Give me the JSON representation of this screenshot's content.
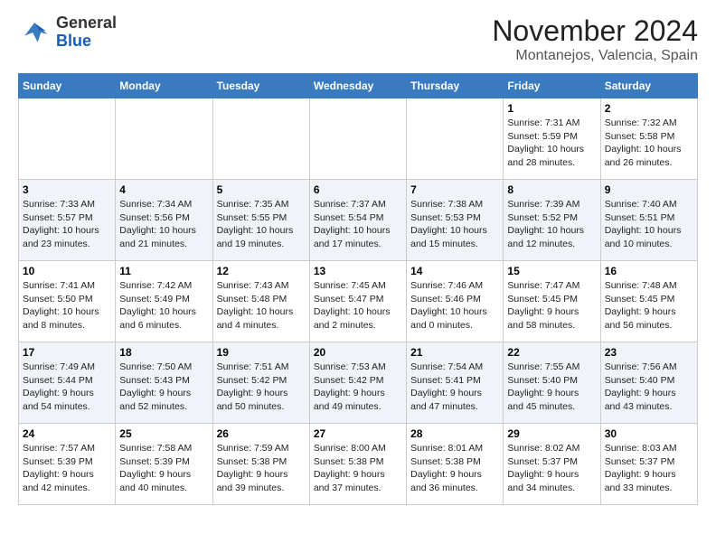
{
  "logo": {
    "general": "General",
    "blue": "Blue"
  },
  "title": "November 2024",
  "subtitle": "Montanejos, Valencia, Spain",
  "days_of_week": [
    "Sunday",
    "Monday",
    "Tuesday",
    "Wednesday",
    "Thursday",
    "Friday",
    "Saturday"
  ],
  "weeks": [
    [
      {
        "day": "",
        "info": ""
      },
      {
        "day": "",
        "info": ""
      },
      {
        "day": "",
        "info": ""
      },
      {
        "day": "",
        "info": ""
      },
      {
        "day": "",
        "info": ""
      },
      {
        "day": "1",
        "info": "Sunrise: 7:31 AM\nSunset: 5:59 PM\nDaylight: 10 hours\nand 28 minutes."
      },
      {
        "day": "2",
        "info": "Sunrise: 7:32 AM\nSunset: 5:58 PM\nDaylight: 10 hours\nand 26 minutes."
      }
    ],
    [
      {
        "day": "3",
        "info": "Sunrise: 7:33 AM\nSunset: 5:57 PM\nDaylight: 10 hours\nand 23 minutes."
      },
      {
        "day": "4",
        "info": "Sunrise: 7:34 AM\nSunset: 5:56 PM\nDaylight: 10 hours\nand 21 minutes."
      },
      {
        "day": "5",
        "info": "Sunrise: 7:35 AM\nSunset: 5:55 PM\nDaylight: 10 hours\nand 19 minutes."
      },
      {
        "day": "6",
        "info": "Sunrise: 7:37 AM\nSunset: 5:54 PM\nDaylight: 10 hours\nand 17 minutes."
      },
      {
        "day": "7",
        "info": "Sunrise: 7:38 AM\nSunset: 5:53 PM\nDaylight: 10 hours\nand 15 minutes."
      },
      {
        "day": "8",
        "info": "Sunrise: 7:39 AM\nSunset: 5:52 PM\nDaylight: 10 hours\nand 12 minutes."
      },
      {
        "day": "9",
        "info": "Sunrise: 7:40 AM\nSunset: 5:51 PM\nDaylight: 10 hours\nand 10 minutes."
      }
    ],
    [
      {
        "day": "10",
        "info": "Sunrise: 7:41 AM\nSunset: 5:50 PM\nDaylight: 10 hours\nand 8 minutes."
      },
      {
        "day": "11",
        "info": "Sunrise: 7:42 AM\nSunset: 5:49 PM\nDaylight: 10 hours\nand 6 minutes."
      },
      {
        "day": "12",
        "info": "Sunrise: 7:43 AM\nSunset: 5:48 PM\nDaylight: 10 hours\nand 4 minutes."
      },
      {
        "day": "13",
        "info": "Sunrise: 7:45 AM\nSunset: 5:47 PM\nDaylight: 10 hours\nand 2 minutes."
      },
      {
        "day": "14",
        "info": "Sunrise: 7:46 AM\nSunset: 5:46 PM\nDaylight: 10 hours\nand 0 minutes."
      },
      {
        "day": "15",
        "info": "Sunrise: 7:47 AM\nSunset: 5:45 PM\nDaylight: 9 hours\nand 58 minutes."
      },
      {
        "day": "16",
        "info": "Sunrise: 7:48 AM\nSunset: 5:45 PM\nDaylight: 9 hours\nand 56 minutes."
      }
    ],
    [
      {
        "day": "17",
        "info": "Sunrise: 7:49 AM\nSunset: 5:44 PM\nDaylight: 9 hours\nand 54 minutes."
      },
      {
        "day": "18",
        "info": "Sunrise: 7:50 AM\nSunset: 5:43 PM\nDaylight: 9 hours\nand 52 minutes."
      },
      {
        "day": "19",
        "info": "Sunrise: 7:51 AM\nSunset: 5:42 PM\nDaylight: 9 hours\nand 50 minutes."
      },
      {
        "day": "20",
        "info": "Sunrise: 7:53 AM\nSunset: 5:42 PM\nDaylight: 9 hours\nand 49 minutes."
      },
      {
        "day": "21",
        "info": "Sunrise: 7:54 AM\nSunset: 5:41 PM\nDaylight: 9 hours\nand 47 minutes."
      },
      {
        "day": "22",
        "info": "Sunrise: 7:55 AM\nSunset: 5:40 PM\nDaylight: 9 hours\nand 45 minutes."
      },
      {
        "day": "23",
        "info": "Sunrise: 7:56 AM\nSunset: 5:40 PM\nDaylight: 9 hours\nand 43 minutes."
      }
    ],
    [
      {
        "day": "24",
        "info": "Sunrise: 7:57 AM\nSunset: 5:39 PM\nDaylight: 9 hours\nand 42 minutes."
      },
      {
        "day": "25",
        "info": "Sunrise: 7:58 AM\nSunset: 5:39 PM\nDaylight: 9 hours\nand 40 minutes."
      },
      {
        "day": "26",
        "info": "Sunrise: 7:59 AM\nSunset: 5:38 PM\nDaylight: 9 hours\nand 39 minutes."
      },
      {
        "day": "27",
        "info": "Sunrise: 8:00 AM\nSunset: 5:38 PM\nDaylight: 9 hours\nand 37 minutes."
      },
      {
        "day": "28",
        "info": "Sunrise: 8:01 AM\nSunset: 5:38 PM\nDaylight: 9 hours\nand 36 minutes."
      },
      {
        "day": "29",
        "info": "Sunrise: 8:02 AM\nSunset: 5:37 PM\nDaylight: 9 hours\nand 34 minutes."
      },
      {
        "day": "30",
        "info": "Sunrise: 8:03 AM\nSunset: 5:37 PM\nDaylight: 9 hours\nand 33 minutes."
      }
    ]
  ]
}
